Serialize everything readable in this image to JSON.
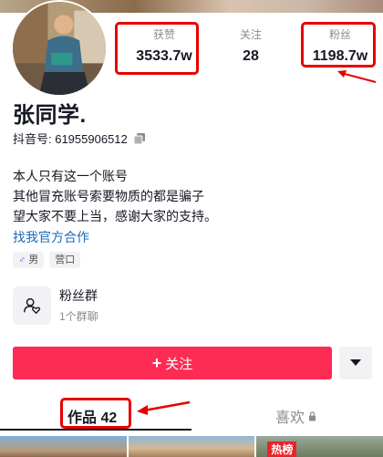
{
  "profile": {
    "name": "张同学.",
    "douyin_id": "抖音号: 61955906512"
  },
  "stats": {
    "likes": {
      "label": "获赞",
      "value": "3533.7w"
    },
    "following": {
      "label": "关注",
      "value": "28"
    },
    "fans": {
      "label": "粉丝",
      "value": "1198.7w"
    }
  },
  "bio": {
    "line1": "本人只有这一个账号",
    "line2": "其他冒充账号索要物质的都是骗子",
    "line3": "望大家不要上当，感谢大家的支持。",
    "link": "找我官方合作"
  },
  "tags": {
    "gender_symbol": "♂",
    "gender": "男",
    "location": "营口"
  },
  "fan_group": {
    "title": "粉丝群",
    "subtitle": "1个群聊"
  },
  "actions": {
    "follow_icon": "+",
    "follow_label": "关注"
  },
  "tabs": {
    "works_label": "作品 42",
    "likes_label": "喜欢"
  },
  "thumbnails": {
    "hot_badge": "热榜"
  },
  "colors": {
    "accent": "#fe2c55",
    "annotation": "#e60000",
    "link": "#1a6bb8"
  }
}
